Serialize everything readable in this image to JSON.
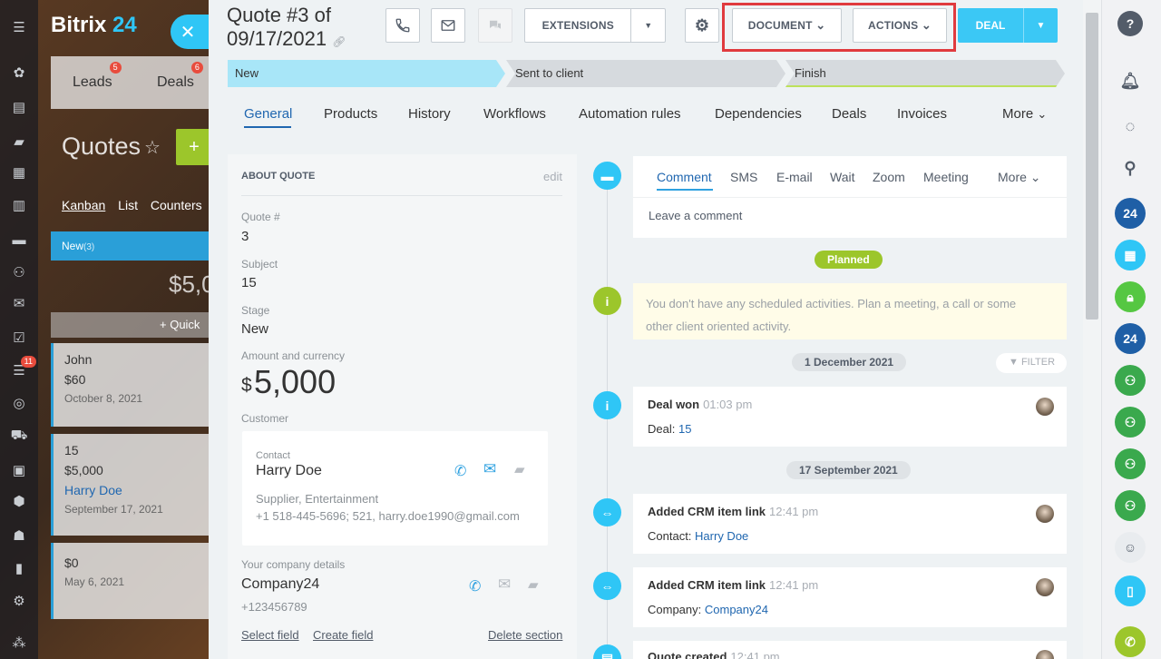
{
  "app": {
    "logo_main": "Bitrix",
    "logo_num": "24",
    "close_glyph": "✕",
    "leftbar_badge": "11"
  },
  "background": {
    "tabs": [
      {
        "label": "Leads",
        "count": "5"
      },
      {
        "label": "Deals",
        "count": "6"
      }
    ],
    "page_title": "Quotes",
    "add_glyph": "+",
    "views": [
      "Kanban",
      "List",
      "Counters"
    ],
    "stage_name": "New",
    "stage_count": "(3)",
    "stage_sum": "$5,0",
    "quick_add": "+ Quick",
    "cards": [
      {
        "name": "John",
        "amount": "$60",
        "date": "October 8, 2021"
      },
      {
        "name": "15",
        "amount": "$5,000",
        "contact": "Harry Doe",
        "date": "September 17, 2021"
      },
      {
        "name": "",
        "amount": "$0",
        "date": "May 6, 2021"
      }
    ]
  },
  "header": {
    "title_line1": "Quote #3 of",
    "title_line2": "09/17/2021",
    "extensions_label": "EXTENSIONS",
    "document_label": "DOCUMENT",
    "actions_label": "ACTIONS",
    "deal_label": "DEAL"
  },
  "stages": [
    {
      "label": "New"
    },
    {
      "label": "Sent to client"
    },
    {
      "label": "Finish"
    }
  ],
  "tabs": [
    {
      "label": "General"
    },
    {
      "label": "Products"
    },
    {
      "label": "History"
    },
    {
      "label": "Workflows"
    },
    {
      "label": "Automation rules"
    },
    {
      "label": "Dependencies"
    },
    {
      "label": "Deals"
    },
    {
      "label": "Invoices"
    },
    {
      "label": "More"
    }
  ],
  "about": {
    "title": "ABOUT QUOTE",
    "edit": "edit",
    "quote_label": "Quote #",
    "quote_value": "3",
    "subject_label": "Subject",
    "subject_value": "15",
    "stage_label": "Stage",
    "stage_value": "New",
    "amount_label": "Amount and currency",
    "amount_symbol": "$",
    "amount_value": "5,000",
    "customer_label": "Customer",
    "contact": {
      "caption": "Contact",
      "name": "Harry Doe",
      "desc": "Supplier, Entertainment",
      "details": "+1 518-445-5696; 521, harry.doe1990@gmail.com"
    },
    "company_label": "Your company details",
    "company_name": "Company24",
    "company_phone": "+123456789",
    "select_field": "Select field",
    "create_field": "Create field",
    "delete_section": "Delete section"
  },
  "timeline": {
    "composer_tabs": [
      {
        "label": "Comment"
      },
      {
        "label": "SMS"
      },
      {
        "label": "E-mail"
      },
      {
        "label": "Wait"
      },
      {
        "label": "Zoom"
      },
      {
        "label": "Meeting"
      },
      {
        "label": "More"
      }
    ],
    "comment_placeholder": "Leave a comment",
    "planned": "Planned",
    "note_line1": "You don't have any scheduled activities. Plan a meeting, a call or some",
    "note_line2": "other client oriented activity.",
    "date1": "1 December 2021",
    "filter": "FILTER",
    "date2": "17 September 2021",
    "events": [
      {
        "title": "Deal won",
        "time": "01:03 pm",
        "label": "Deal:",
        "value": "15"
      },
      {
        "title": "Added CRM item link",
        "time": "12:41 pm",
        "label": "Contact:",
        "value": "Harry Doe"
      },
      {
        "title": "Added CRM item link",
        "time": "12:41 pm",
        "label": "Company:",
        "value": "Company24"
      },
      {
        "title": "Quote created",
        "time": "12:41 pm"
      }
    ]
  },
  "rightbar": {
    "help": "?",
    "b24": "24"
  },
  "colors": {
    "accent": "#2fc6f6",
    "link": "#2067b0",
    "green": "#9cc62b",
    "highlight": "#e03a3e"
  }
}
